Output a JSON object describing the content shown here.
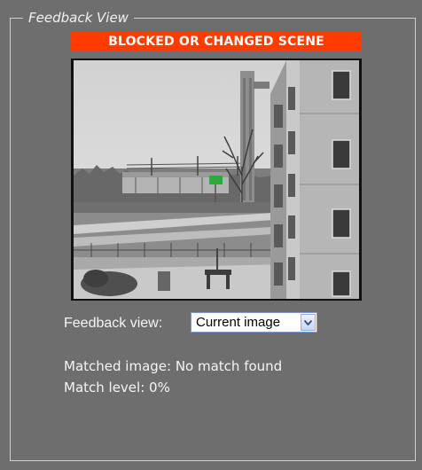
{
  "panel": {
    "legend": "Feedback View",
    "alert": "BLOCKED OR CHANGED SCENE",
    "camera_view_shown": true
  },
  "controls": {
    "feedback_view_label": "Feedback view:",
    "feedback_view_selected": "Current image"
  },
  "status": {
    "matched_image_text": "Matched image: No match found",
    "match_level_text": "Match level: 0%"
  },
  "colors": {
    "panel_background": "#6e6e6e",
    "alert_background": "#ff3b00",
    "text": "#f5f5f5"
  }
}
